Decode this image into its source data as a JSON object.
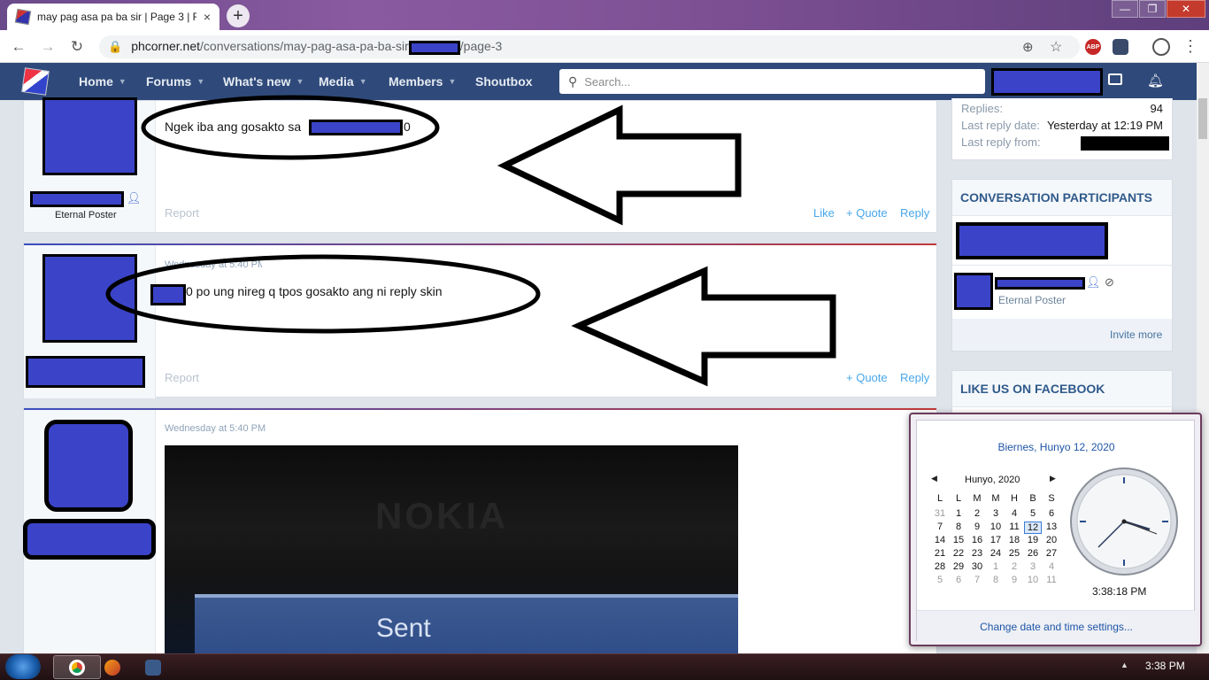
{
  "browser": {
    "tab_title": "may pag asa pa ba sir | Page 3 | F",
    "close_glyph": "×",
    "new_tab_glyph": "+",
    "url_domain": "phcorner.net",
    "url_path_1": "/conversations/may-pag-asa-pa-ba-sir",
    "url_path_2": "/page-3",
    "ext_abp": "ABP"
  },
  "nav": {
    "items": [
      {
        "label": "Home"
      },
      {
        "label": "Forums"
      },
      {
        "label": "What's new"
      },
      {
        "label": "Media"
      },
      {
        "label": "Members"
      },
      {
        "label": "Shoutbox"
      }
    ],
    "search_placeholder": "Search..."
  },
  "posts": [
    {
      "user_title": "Eternal Poster",
      "message_start": "Ngek iba ang gosakto sa",
      "message_end": "0",
      "report": "Report",
      "like": "Like",
      "quote": "+ Quote",
      "reply": "Reply"
    },
    {
      "date": "Wednesday at 5:40 PM",
      "message": "0 po ung nireg q tpos gosakto ang ni reply skin",
      "report": "Report",
      "quote": "+ Quote",
      "reply": "Reply"
    },
    {
      "date": "Wednesday at 5:40 PM",
      "image_text_1": "NOKIA",
      "image_text_2": "Sent"
    }
  ],
  "sidebar": {
    "replies_label": "Replies:",
    "replies_value": "94",
    "last_reply_date_label": "Last reply date:",
    "last_reply_date_value": "Yesterday at 12:19 PM",
    "last_reply_from_label": "Last reply from:",
    "participants_heading": "CONVERSATION PARTICIPANTS",
    "participant_title": "Eternal Poster",
    "invite_more": "Invite more",
    "facebook_heading": "LIKE US ON FACEBOOK"
  },
  "calendar": {
    "header": "Biernes, Hunyo 12, 2020",
    "month": "Hunyo, 2020",
    "weekdays": [
      "L",
      "L",
      "M",
      "M",
      "H",
      "B",
      "S"
    ],
    "weeks": [
      [
        "31",
        "1",
        "2",
        "3",
        "4",
        "5",
        "6"
      ],
      [
        "7",
        "8",
        "9",
        "10",
        "11",
        "12",
        "13"
      ],
      [
        "14",
        "15",
        "16",
        "17",
        "18",
        "19",
        "20"
      ],
      [
        "21",
        "22",
        "23",
        "24",
        "25",
        "26",
        "27"
      ],
      [
        "28",
        "29",
        "30",
        "1",
        "2",
        "3",
        "4"
      ],
      [
        "5",
        "6",
        "7",
        "8",
        "9",
        "10",
        "11"
      ]
    ],
    "selected_day": "12",
    "time": "3:38:18 PM",
    "change_link": "Change date and time settings..."
  },
  "taskbar": {
    "clock": "3:38 PM"
  },
  "colors": {
    "nav_bg": "#2f4a7a",
    "redaction_fill": "#3b44c8",
    "link_blue": "#47a7eb"
  }
}
